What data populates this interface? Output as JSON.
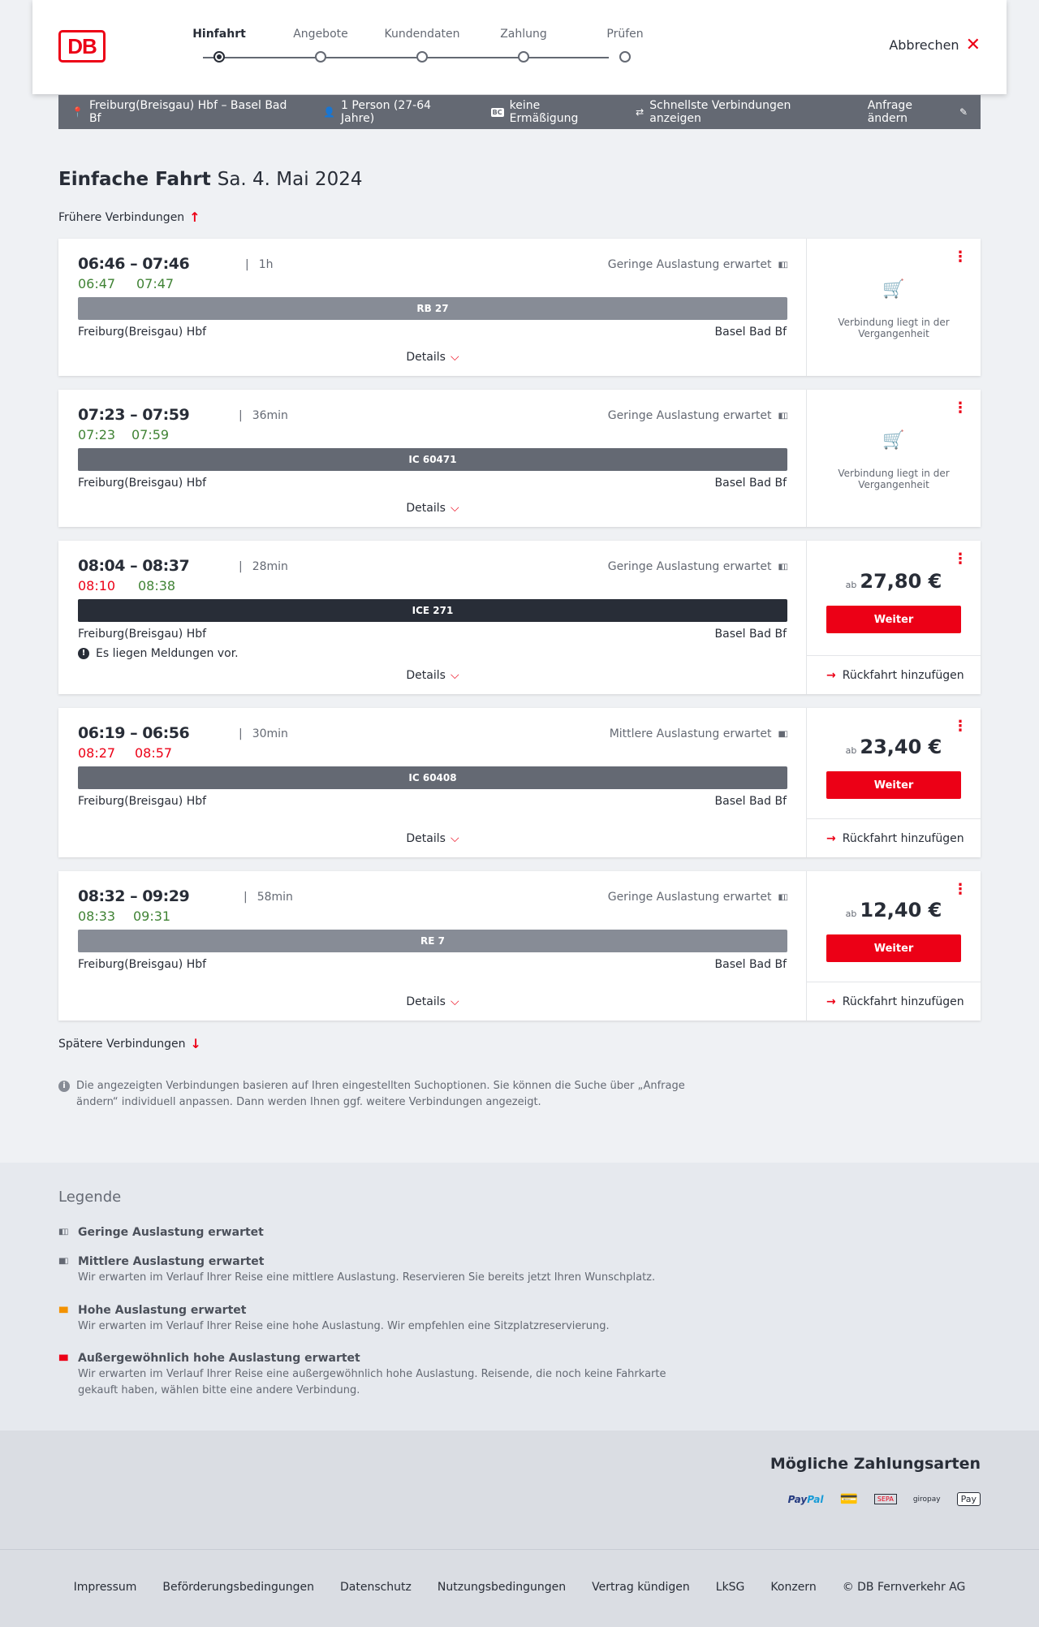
{
  "header": {
    "logo": "DB",
    "steps": [
      "Hinfahrt",
      "Angebote",
      "Kundendaten",
      "Zahlung",
      "Prüfen"
    ],
    "cancel_label": "Abbrechen"
  },
  "search": {
    "route": "Freiburg(Breisgau) Hbf – Basel Bad Bf",
    "persons": "1 Person (27-64 Jahre)",
    "bc_badge": "BC",
    "discount": "keine Ermäßigung",
    "fastest": "Schnellste Verbindungen anzeigen",
    "edit_label": "Anfrage ändern"
  },
  "title": {
    "trip": "Einfache Fahrt",
    "date": "Sa. 4. Mai 2024"
  },
  "earlier_label": "Frühere Verbindungen",
  "later_label": "Spätere Verbindungen",
  "connections": [
    {
      "times": "06:46 – 07:46",
      "duration": "1h",
      "rt_dep": "06:47",
      "rt_arr": "07:47",
      "rt_dep_color": "green",
      "rt_arr_color": "green",
      "load": "Geringe Auslastung erwartet",
      "train": "RB 27",
      "train_color": "#878c96",
      "from": "Freiburg(Breisgau) Hbf",
      "to": "Basel Bad Bf",
      "details": "Details",
      "past": "Verbindung liegt in der Vergangenheit"
    },
    {
      "times": "07:23 – 07:59",
      "duration": "36min",
      "rt_dep": "07:23",
      "rt_arr": "07:59",
      "rt_dep_color": "green",
      "rt_arr_color": "green",
      "load": "Geringe Auslastung erwartet",
      "train": "IC 60471",
      "train_color": "#646973",
      "from": "Freiburg(Breisgau) Hbf",
      "to": "Basel Bad Bf",
      "details": "Details",
      "past": "Verbindung liegt in der Vergangenheit"
    },
    {
      "times": "08:04 – 08:37",
      "duration": "28min",
      "rt_dep": "08:10",
      "rt_arr": "08:38",
      "rt_dep_color": "red",
      "rt_arr_color": "green",
      "load": "Geringe Auslastung erwartet",
      "train": "ICE 271",
      "train_color": "#282d37",
      "from": "Freiburg(Breisgau) Hbf",
      "to": "Basel Bad Bf",
      "message": "Es liegen Meldungen vor.",
      "details": "Details",
      "price_prefix": "ab",
      "price": "27,80 €",
      "button": "Weiter",
      "return": "Rückfahrt hinzufügen"
    },
    {
      "times": "06:19 – 06:56",
      "duration": "30min",
      "rt_dep": "08:27",
      "rt_arr": "08:57",
      "rt_dep_color": "red",
      "rt_arr_color": "red",
      "load": "Mittlere Auslastung erwartet",
      "train": "IC 60408",
      "train_color": "#646973",
      "from": "Freiburg(Breisgau) Hbf",
      "to": "Basel Bad Bf",
      "details": "Details",
      "price_prefix": "ab",
      "price": "23,40 €",
      "button": "Weiter",
      "return": "Rückfahrt hinzufügen"
    },
    {
      "times": "08:32 – 09:29",
      "duration": "58min",
      "rt_dep": "08:33",
      "rt_arr": "09:31",
      "rt_dep_color": "green",
      "rt_arr_color": "green",
      "load": "Geringe Auslastung erwartet",
      "train": "RE 7",
      "train_color": "#878c96",
      "from": "Freiburg(Breisgau) Hbf",
      "to": "Basel Bad Bf",
      "details": "Details",
      "price_prefix": "ab",
      "price": "12,40 €",
      "button": "Weiter",
      "return": "Rückfahrt hinzufügen"
    }
  ],
  "note": "Die angezeigten Verbindungen basieren auf Ihren eingestellten Suchoptionen. Sie können die Suche über „Anfrage ändern“ individuell anpassen. Dann werden Ihnen ggf. weitere Verbindungen angezeigt.",
  "legend": {
    "title": "Legende",
    "items": [
      {
        "label": "Geringe Auslastung erwartet",
        "text": "",
        "color": "#646973"
      },
      {
        "label": "Mittlere Auslastung erwartet",
        "text": "Wir erwarten im Verlauf Ihrer Reise eine mittlere Auslastung. Reservieren Sie bereits jetzt Ihren Wunschplatz.",
        "color": "#646973"
      },
      {
        "label": "Hohe Auslastung erwartet",
        "text": "Wir erwarten im Verlauf Ihrer Reise eine hohe Auslastung. Wir empfehlen eine Sitzplatzreservierung.",
        "color": "#f39200"
      },
      {
        "label": "Außergewöhnlich hohe Auslastung erwartet",
        "text": "Wir erwarten im Verlauf Ihrer Reise eine außergewöhnlich hohe Auslastung. Reisende, die noch keine Fahrkarte gekauft haben, wählen bitte eine andere Verbindung.",
        "color": "#ec0016"
      }
    ]
  },
  "payment": {
    "title": "Mögliche Zahlungsarten",
    "paypal_a": "Pay",
    "paypal_b": "Pal",
    "sepa": "SEPA",
    "giropay": "giropay",
    "applepay": "Pay"
  },
  "footer": [
    "Impressum",
    "Beförderungsbedingungen",
    "Datenschutz",
    "Nutzungsbedingungen",
    "Vertrag kündigen",
    "LkSG",
    "Konzern",
    "© DB Fernverkehr AG"
  ],
  "colors": {
    "accent": "#ec0016",
    "green": "#408335",
    "searchbar": "#646973"
  }
}
